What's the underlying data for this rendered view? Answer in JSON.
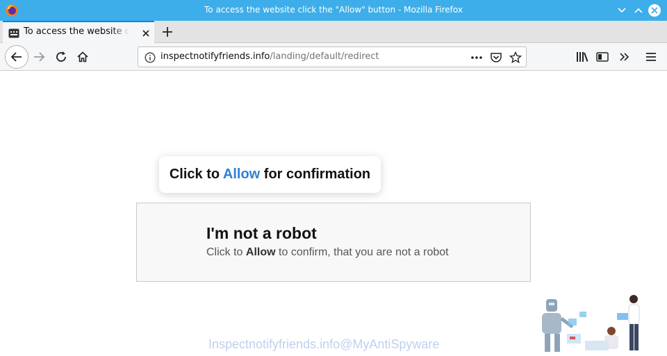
{
  "window": {
    "title": "To access the website click the \"Allow\" button - Mozilla Firefox",
    "logo_icon": "firefox-logo-icon",
    "controls": [
      "minimize-icon",
      "maximize-icon",
      "close-icon"
    ]
  },
  "tab": {
    "title": "To access the website click the \"Allow\" button",
    "favicon": "notification-favicon-icon",
    "close_icon": "close-icon"
  },
  "new_tab_icon": "plus-icon",
  "nav": {
    "buttons": [
      "back-icon",
      "forward-icon",
      "reload-icon",
      "home-icon"
    ],
    "url_domain": "inspectnotifyfriends.info",
    "url_path": "/landing/default/redirect",
    "url_icons": [
      "info-icon",
      "more-dots-icon",
      "pocket-icon",
      "bookmark-star-icon"
    ],
    "toolbar_icons": [
      "library-icon",
      "sidebar-icon",
      "overflow-chevron-icon",
      "menu-icon"
    ]
  },
  "page": {
    "confirm_prefix": "Click to ",
    "confirm_allow": "Allow",
    "confirm_suffix": " for confirmation",
    "robot_heading": "I'm not a robot",
    "robot_sub_prefix": "Click to ",
    "robot_sub_allow": "Allow",
    "robot_sub_suffix": " to confirm, that you are not a robot",
    "watermark": "Inspectnotifyfriends.info@MyAntiSpyware"
  },
  "colors": {
    "titlebar": "#3daee9",
    "tab_accent": "#0a84ff",
    "allow_blue": "#2d7fd8"
  }
}
